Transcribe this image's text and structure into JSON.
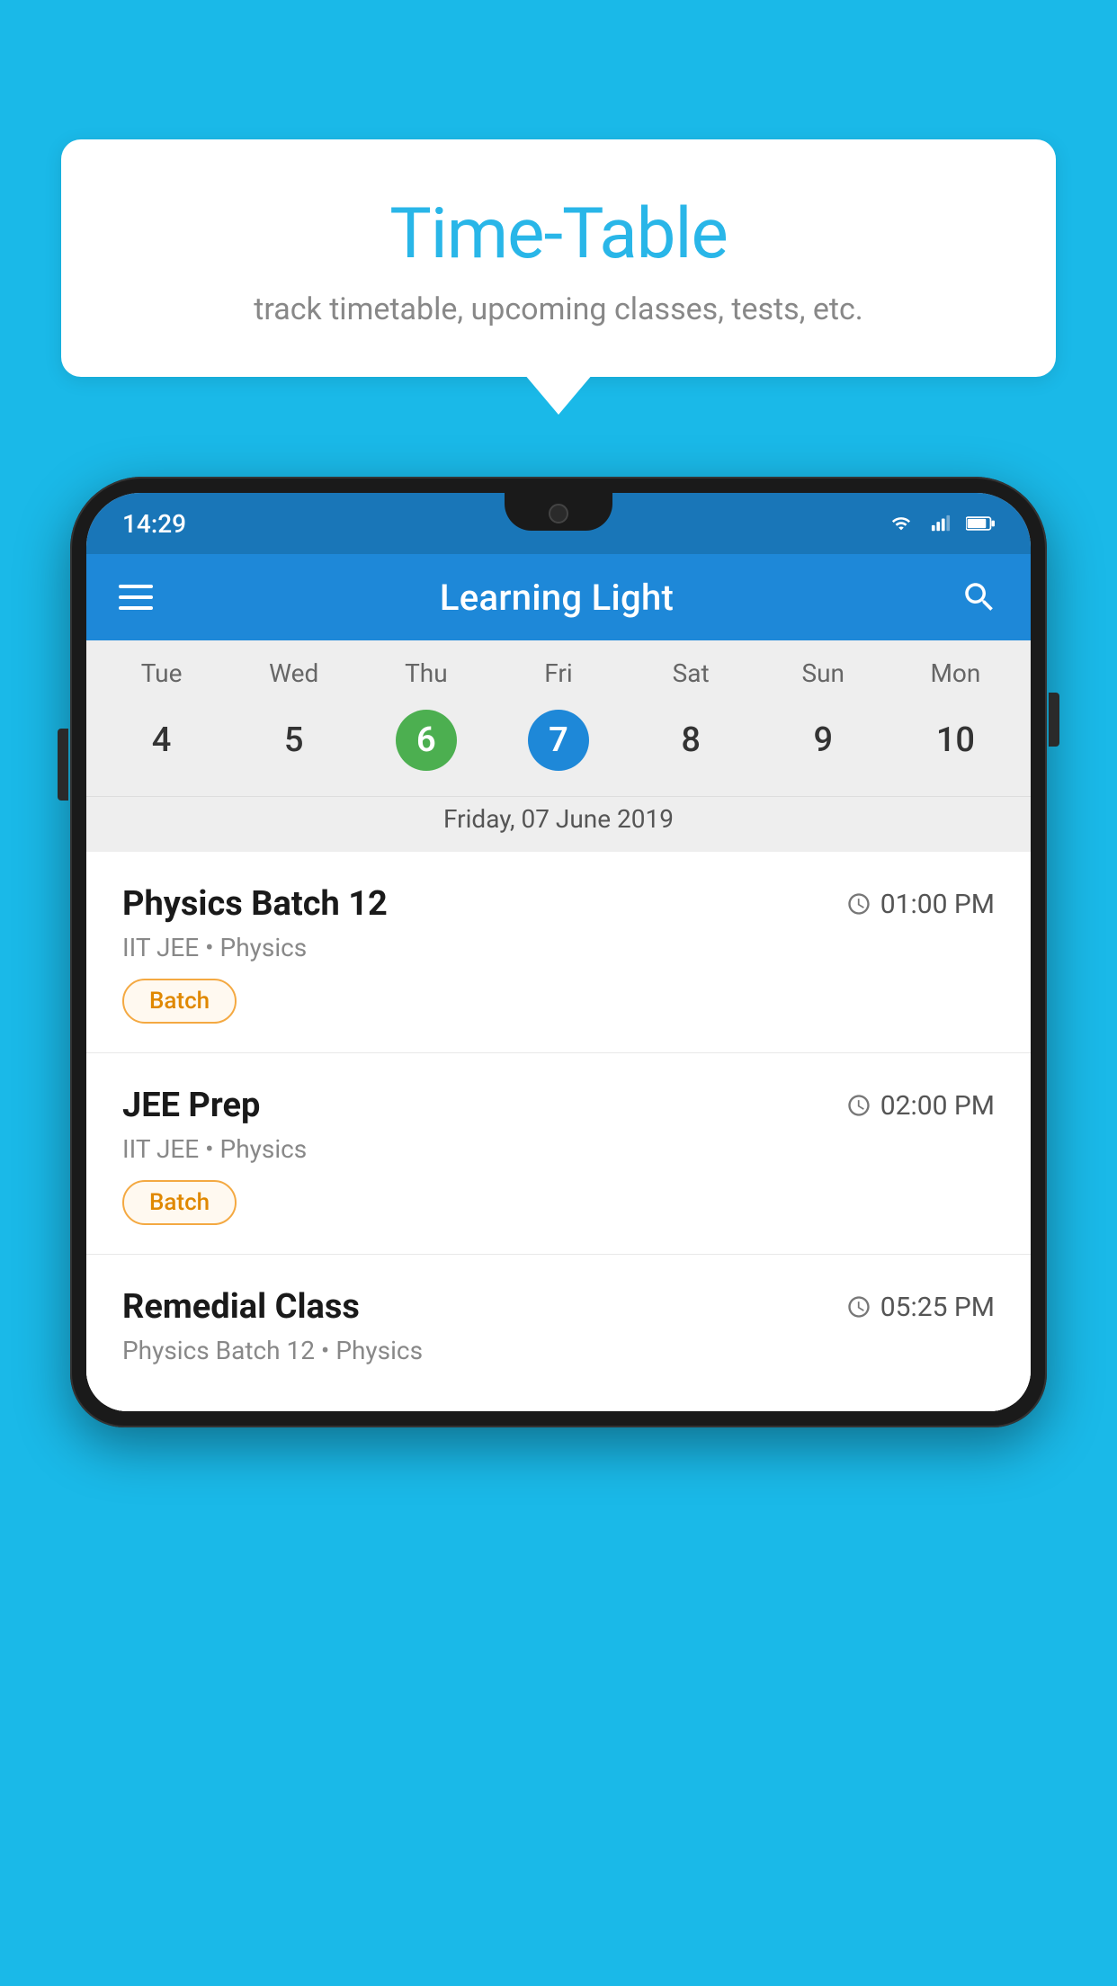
{
  "background_color": "#1ab9e8",
  "speech_bubble": {
    "title": "Time-Table",
    "subtitle": "track timetable, upcoming classes, tests, etc."
  },
  "phone": {
    "status_bar": {
      "time": "14:29"
    },
    "app_bar": {
      "title": "Learning Light"
    },
    "calendar": {
      "weekdays": [
        "Tue",
        "Wed",
        "Thu",
        "Fri",
        "Sat",
        "Sun",
        "Mon"
      ],
      "dates": [
        {
          "num": "4",
          "state": "normal"
        },
        {
          "num": "5",
          "state": "normal"
        },
        {
          "num": "6",
          "state": "today"
        },
        {
          "num": "7",
          "state": "selected"
        },
        {
          "num": "8",
          "state": "normal"
        },
        {
          "num": "9",
          "state": "normal"
        },
        {
          "num": "10",
          "state": "normal"
        }
      ],
      "selected_date_label": "Friday, 07 June 2019"
    },
    "schedule": [
      {
        "name": "Physics Batch 12",
        "time": "01:00 PM",
        "meta": "IIT JEE • Physics",
        "badge": "Batch"
      },
      {
        "name": "JEE Prep",
        "time": "02:00 PM",
        "meta": "IIT JEE • Physics",
        "badge": "Batch"
      },
      {
        "name": "Remedial Class",
        "time": "05:25 PM",
        "meta": "Physics Batch 12 • Physics",
        "badge": null
      }
    ]
  }
}
